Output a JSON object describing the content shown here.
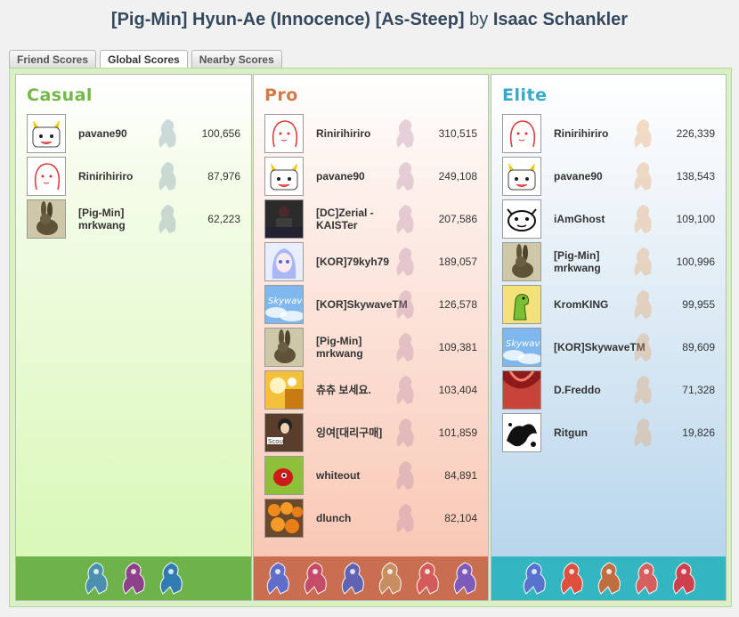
{
  "title": {
    "song": "[Pig-Min] Hyun-Ae (Innocence) [As-Steep]",
    "by": "by",
    "author": "Isaac Schankler"
  },
  "tabs": [
    {
      "label": "Friend Scores"
    },
    {
      "label": "Global Scores"
    },
    {
      "label": "Nearby Scores"
    }
  ],
  "panels": {
    "casual": {
      "title": "Casual",
      "color": "#74b84a",
      "rows": [
        {
          "name": "pavane90",
          "score": "100,656",
          "avatar": "cat-avatar"
        },
        {
          "name": "Rinirihiriro",
          "score": "87,976",
          "avatar": "sketch-girl-avatar"
        },
        {
          "name": "[Pig-Min] mrkwang",
          "score": "62,223",
          "avatar": "hare-avatar"
        }
      ]
    },
    "pro": {
      "title": "Pro",
      "color": "#d47a47",
      "rows": [
        {
          "name": "Rinirihiriro",
          "score": "310,515",
          "avatar": "sketch-girl-avatar"
        },
        {
          "name": "pavane90",
          "score": "249,108",
          "avatar": "cat-avatar"
        },
        {
          "name": "[DC]Zerial - KAISTer",
          "score": "207,586",
          "avatar": "dark-figure-avatar"
        },
        {
          "name": "[KOR]79kyh79",
          "score": "189,057",
          "avatar": "anime-girl-avatar"
        },
        {
          "name": "[KOR]SkywaveTM",
          "score": "126,578",
          "avatar": "skywave-avatar"
        },
        {
          "name": "[Pig-Min] mrkwang",
          "score": "109,381",
          "avatar": "hare-avatar"
        },
        {
          "name": "츄츄 보세요.",
          "score": "103,404",
          "avatar": "yellow-photo-avatar"
        },
        {
          "name": "잉여[대리구매]",
          "score": "101,859",
          "avatar": "scout-avatar"
        },
        {
          "name": "whiteout",
          "score": "84,891",
          "avatar": "red-blob-avatar"
        },
        {
          "name": "dlunch",
          "score": "82,104",
          "avatar": "oranges-avatar"
        }
      ]
    },
    "elite": {
      "title": "Elite",
      "color": "#38a9c9",
      "rows": [
        {
          "name": "Rinirihiriro",
          "score": "226,339",
          "avatar": "sketch-girl-avatar"
        },
        {
          "name": "pavane90",
          "score": "138,543",
          "avatar": "cat-avatar"
        },
        {
          "name": "iAmGhost",
          "score": "109,100",
          "avatar": "ghost-face-avatar"
        },
        {
          "name": "[Pig-Min] mrkwang",
          "score": "100,996",
          "avatar": "hare-avatar"
        },
        {
          "name": "KromKING",
          "score": "99,955",
          "avatar": "dino-avatar"
        },
        {
          "name": "[KOR]SkywaveTM",
          "score": "89,609",
          "avatar": "skywave-avatar"
        },
        {
          "name": "D.Freddo",
          "score": "71,328",
          "avatar": "red-abstract-avatar"
        },
        {
          "name": "Ritgun",
          "score": "19,826",
          "avatar": "ink-splash-avatar"
        }
      ]
    }
  },
  "avatar_texts": {
    "skywave": "Skywave",
    "scout": "Scout"
  }
}
